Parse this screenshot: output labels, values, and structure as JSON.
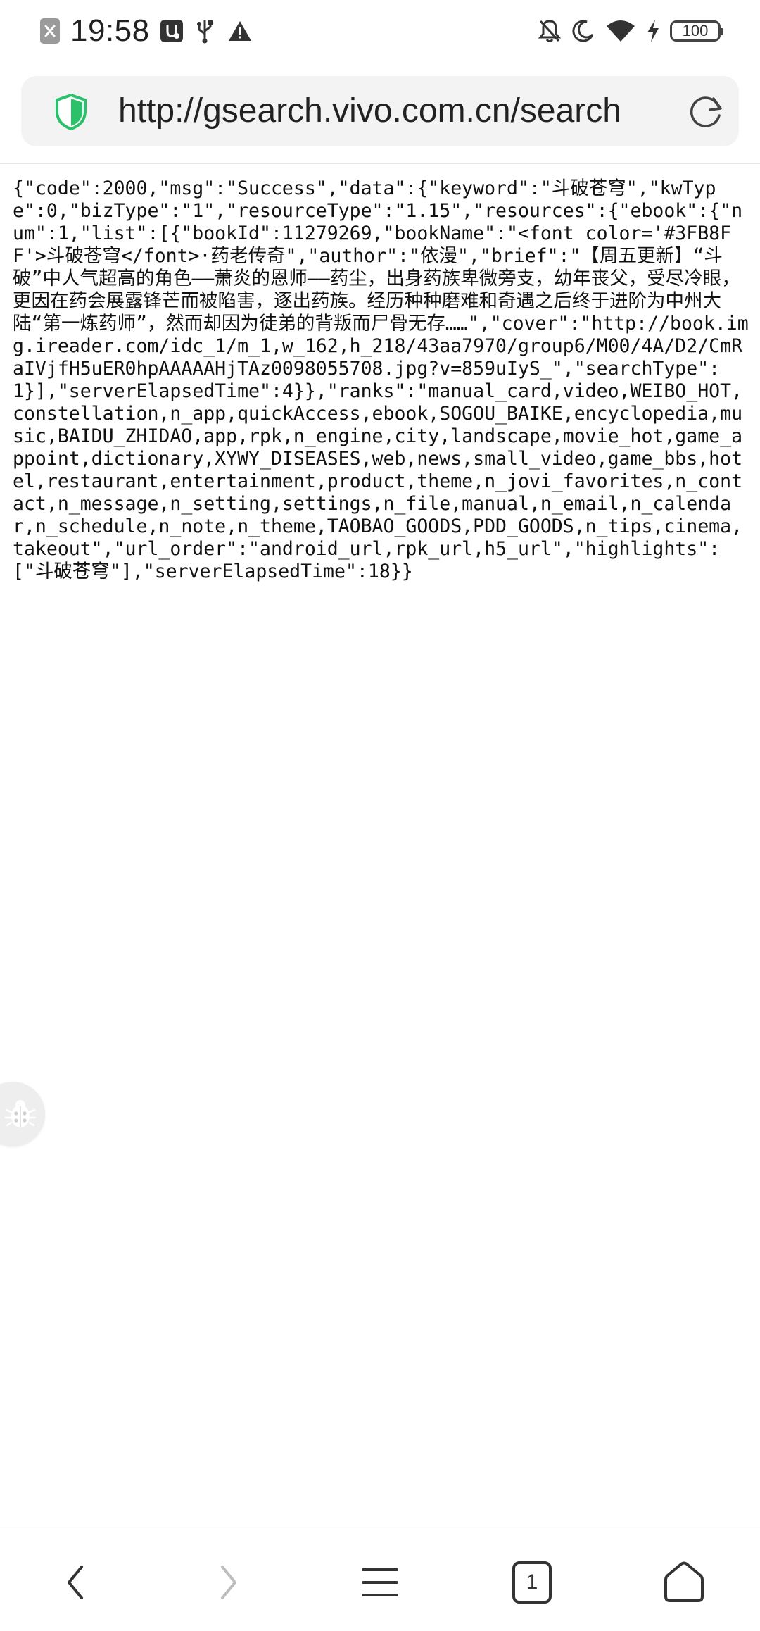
{
  "status_bar": {
    "time": "19:58",
    "battery": "100",
    "left_icons": [
      "close-notification-icon",
      "usb-debug-icon",
      "usb-icon",
      "warning-icon"
    ],
    "right_icons": [
      "mute-icon",
      "moon-icon",
      "wifi-icon",
      "charging-icon",
      "battery-icon"
    ]
  },
  "browser": {
    "url": "http://gsearch.vivo.com.cn/search",
    "tab_count": "1",
    "shield_color": "#2bc16b"
  },
  "page": {
    "body_text": "{\"code\":2000,\"msg\":\"Success\",\"data\":{\"keyword\":\"斗破苍穹\",\"kwType\":0,\"bizType\":\"1\",\"resourceType\":\"1.15\",\"resources\":{\"ebook\":{\"num\":1,\"list\":[{\"bookId\":11279269,\"bookName\":\"<font color='#3FB8FF'>斗破苍穹</font>·药老传奇\",\"author\":\"依漫\",\"brief\":\"【周五更新】“斗破”中人气超高的角色——萧炎的恩师——药尘，出身药族卑微旁支，幼年丧父，受尽冷眼，更因在药会展露锋芒而被陷害，逐出药族。经历种种磨难和奇遇之后终于进阶为中州大陆“第一炼药师”，然而却因为徒弟的背叛而尸骨无存……\",\"cover\":\"http://book.img.ireader.com/idc_1/m_1,w_162,h_218/43aa7970/group6/M00/4A/D2/CmRaIVjfH5uER0hpAAAAAHjTAz0098055708.jpg?v=859uIyS_\",\"searchType\":1}],\"serverElapsedTime\":4}},\"ranks\":\"manual_card,video,WEIBO_HOT,constellation,n_app,quickAccess,ebook,SOGOU_BAIKE,encyclopedia,music,BAIDU_ZHIDAO,app,rpk,n_engine,city,landscape,movie_hot,game_appoint,dictionary,XYWY_DISEASES,web,news,small_video,game_bbs,hotel,restaurant,entertainment,product,theme,n_jovi_favorites,n_contact,n_message,n_setting,settings,n_file,manual,n_email,n_calendar,n_schedule,n_note,n_theme,TAOBAO_GOODS,PDD_GOODS,n_tips,cinema,takeout\",\"url_order\":\"android_url,rpk_url,h5_url\",\"highlights\":[\"斗破苍穹\"],\"serverElapsedTime\":18}}"
  },
  "bottom_nav": {
    "items": [
      "back-icon",
      "forward-icon",
      "menu-icon",
      "tabs-icon",
      "home-icon"
    ]
  }
}
